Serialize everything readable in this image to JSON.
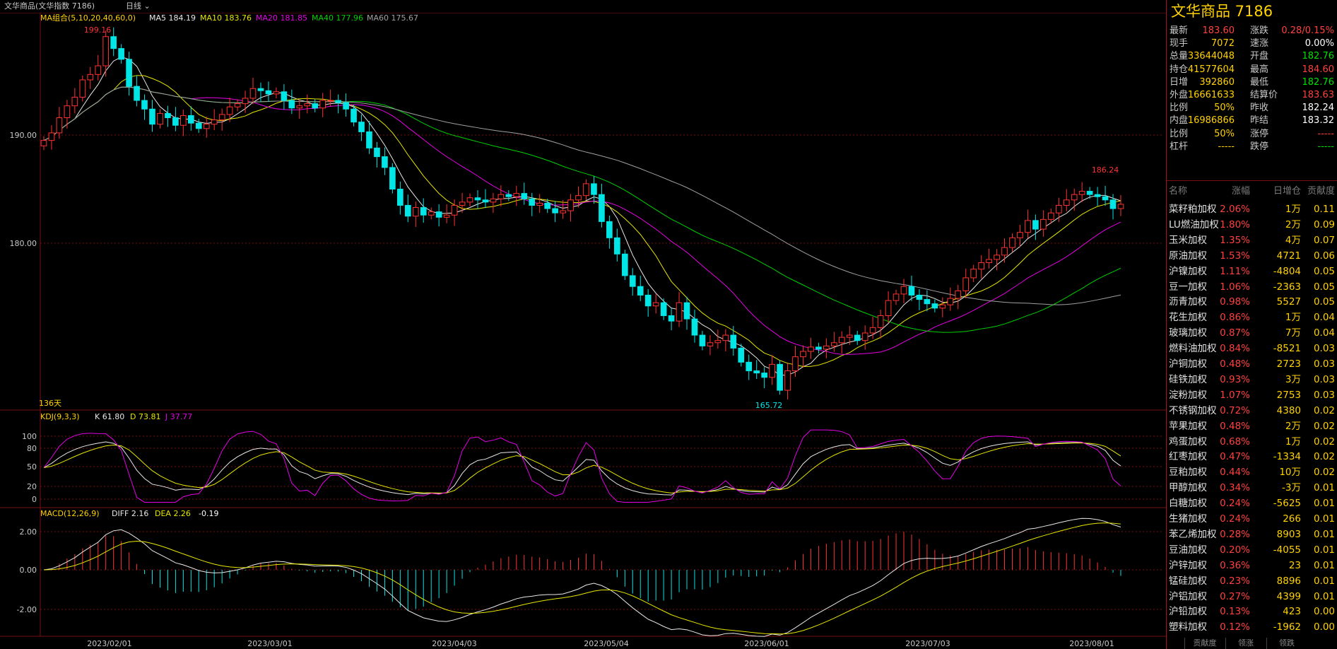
{
  "window": {
    "title": "文华商品(文华指数 7186)",
    "period": "日线"
  },
  "colors": {
    "up": "#ff3232",
    "down": "#00e5e5",
    "ma5": "#e8e8e8",
    "ma10": "#e6e600",
    "ma20": "#e600e6",
    "ma40": "#00d000",
    "ma60": "#a0a0a0",
    "grid": "#7a1010",
    "label": "#ffd200"
  },
  "main_panel": {
    "ma_legend": {
      "name": "MA组合(5,10,20,40,60,0)",
      "ma5": "MA5 184.19",
      "ma10": "MA10 183.76",
      "ma20": "MA20 181.85",
      "ma40": "MA40 177.96",
      "ma60": "MA60 175.67"
    },
    "y_ticks": [
      "190.00",
      "180.00"
    ],
    "high_label": "199.16",
    "low_label": "165.72",
    "recent_high_label": "186.24",
    "day_count": "136天"
  },
  "kdj_panel": {
    "name": "KDJ(9,3,3)",
    "k": "K 61.80",
    "d": "D 73.81",
    "j": "J 37.77",
    "y_ticks": [
      "100",
      "80",
      "50",
      "20",
      "0"
    ]
  },
  "macd_panel": {
    "name": "MACD(12,26,9)",
    "diff": "DIFF 2.16",
    "dea": "DEA 2.26",
    "macd": "-0.19",
    "y_ticks": [
      "2.00",
      "0.00",
      "-2.00"
    ]
  },
  "x_axis": {
    "ticks": [
      "2023/02/01",
      "2023/03/01",
      "2023/04/03",
      "2023/05/04",
      "2023/06/01",
      "2023/07/03",
      "2023/08/01"
    ]
  },
  "chart_data": {
    "type": "candlestick",
    "y_range": [
      165.72,
      199.16
    ],
    "ma_last": {
      "MA5": 184.19,
      "MA10": 183.76,
      "MA20": 181.85,
      "MA40": 177.96,
      "MA60": 175.67
    },
    "close_approx": [
      189.5,
      190.2,
      191.6,
      192.7,
      193.5,
      195.1,
      195.6,
      196.4,
      199.1,
      198.0,
      197.0,
      194.5,
      193.2,
      192.4,
      191.0,
      192.0,
      191.6,
      190.9,
      191.8,
      191.1,
      190.6,
      191.0,
      191.4,
      191.9,
      192.6,
      192.9,
      193.4,
      194.3,
      194.1,
      193.8,
      194.0,
      193.2,
      192.5,
      192.7,
      192.9,
      192.5,
      193.2,
      193.2,
      193.0,
      192.4,
      191.2,
      190.3,
      188.8,
      188.0,
      187.0,
      185.0,
      183.5,
      182.5,
      183.3,
      182.6,
      182.9,
      182.4,
      182.6,
      183.5,
      183.8,
      184.2,
      184.0,
      183.8,
      184.1,
      184.5,
      184.3,
      184.6,
      184.1,
      183.5,
      183.7,
      183.2,
      182.8,
      183.0,
      184.0,
      184.4,
      185.5,
      184.5,
      182.0,
      180.5,
      179.0,
      177.0,
      176.0,
      175.2,
      174.2,
      174.5,
      173.3,
      172.8,
      174.5,
      173.0,
      171.5,
      170.5,
      170.8,
      171.0,
      171.5,
      170.3,
      169.0,
      168.2,
      168.0,
      167.6,
      168.8,
      166.4,
      168.2,
      169.5,
      170.0,
      170.4,
      170.2,
      170.5,
      170.8,
      171.3,
      171.5,
      171.0,
      171.7,
      172.2,
      173.3,
      174.7,
      175.3,
      176.0,
      175.2,
      174.8,
      174.4,
      174.0,
      174.3,
      174.9,
      175.6,
      176.8,
      177.6,
      178.2,
      178.5,
      178.9,
      179.6,
      180.5,
      181.0,
      182.1,
      181.3,
      182.2,
      182.8,
      183.5,
      184.0,
      184.5,
      184.8,
      184.5,
      184.3,
      184.0,
      183.2,
      183.6
    ],
    "kdj_last": {
      "K": 61.8,
      "D": 73.81,
      "J": 37.77
    },
    "macd_last": {
      "DIFF": 2.16,
      "DEA": 2.26,
      "MACD": -0.19
    }
  },
  "quote": {
    "title": "文华商品 7186",
    "rows": [
      {
        "l1": "最新",
        "v1": "183.60",
        "c1": "#ff4040",
        "l2": "涨跌",
        "v2": "0.28/0.15%",
        "c2": "#ff4040"
      },
      {
        "l1": "现手",
        "v1": "7072",
        "c1": "#ffd200",
        "l2": "速涨",
        "v2": "0.00%",
        "c2": "#ffffff"
      },
      {
        "l1": "总量",
        "v1": "33644048",
        "c1": "#ffd200",
        "l2": "开盘",
        "v2": "182.76",
        "c2": "#00e000"
      },
      {
        "l1": "持仓",
        "v1": "41577604",
        "c1": "#ffd200",
        "l2": "最高",
        "v2": "184.60",
        "c2": "#ff4040"
      },
      {
        "l1": "日增",
        "v1": "392860",
        "c1": "#ffd200",
        "l2": "最低",
        "v2": "182.76",
        "c2": "#00e000"
      },
      {
        "l1": "外盘",
        "v1": "16661633",
        "c1": "#ffd200",
        "l2": "结算价",
        "v2": "183.63",
        "c2": "#ff4040"
      },
      {
        "l1": "比例",
        "v1": "50%",
        "c1": "#ffd200",
        "l2": "昨收",
        "v2": "182.24",
        "c2": "#ffffff"
      },
      {
        "l1": "内盘",
        "v1": "16986866",
        "c1": "#ffd200",
        "l2": "昨结",
        "v2": "183.32",
        "c2": "#ffffff"
      },
      {
        "l1": "比例",
        "v1": "50%",
        "c1": "#ffd200",
        "l2": "涨停",
        "v2": "-----",
        "c2": "#ff4040"
      },
      {
        "l1": "杠杆",
        "v1": "-----",
        "c1": "#ffd200",
        "l2": "跌停",
        "v2": "-----",
        "c2": "#00e000"
      }
    ]
  },
  "contrib_table": {
    "headers": [
      "名称",
      "涨幅",
      "日增仓",
      "贡献度"
    ],
    "rows": [
      [
        "菜籽粕加权",
        "2.06%",
        "1万",
        "0.11"
      ],
      [
        "LU燃油加权",
        "1.80%",
        "2万",
        "0.09"
      ],
      [
        "玉米加权",
        "1.35%",
        "4万",
        "0.07"
      ],
      [
        "原油加权",
        "1.53%",
        "4721",
        "0.06"
      ],
      [
        "沪镍加权",
        "1.11%",
        "-4804",
        "0.05"
      ],
      [
        "豆一加权",
        "1.06%",
        "-2363",
        "0.05"
      ],
      [
        "沥青加权",
        "0.98%",
        "5527",
        "0.05"
      ],
      [
        "花生加权",
        "0.86%",
        "1万",
        "0.04"
      ],
      [
        "玻璃加权",
        "0.87%",
        "7万",
        "0.04"
      ],
      [
        "燃料油加权",
        "0.84%",
        "-8521",
        "0.03"
      ],
      [
        "沪铜加权",
        "0.48%",
        "2723",
        "0.03"
      ],
      [
        "硅铁加权",
        "0.93%",
        "3万",
        "0.03"
      ],
      [
        "淀粉加权",
        "1.07%",
        "2753",
        "0.03"
      ],
      [
        "不锈钢加权",
        "0.72%",
        "4380",
        "0.02"
      ],
      [
        "苹果加权",
        "0.48%",
        "2万",
        "0.02"
      ],
      [
        "鸡蛋加权",
        "0.68%",
        "1万",
        "0.02"
      ],
      [
        "红枣加权",
        "0.47%",
        "-1334",
        "0.02"
      ],
      [
        "豆粕加权",
        "0.44%",
        "10万",
        "0.02"
      ],
      [
        "甲醇加权",
        "0.34%",
        "-3万",
        "0.01"
      ],
      [
        "白糖加权",
        "0.24%",
        "-5625",
        "0.01"
      ],
      [
        "生猪加权",
        "0.24%",
        "266",
        "0.01"
      ],
      [
        "苯乙烯加权",
        "0.28%",
        "8903",
        "0.01"
      ],
      [
        "豆油加权",
        "0.20%",
        "-4055",
        "0.01"
      ],
      [
        "沪锌加权",
        "0.36%",
        "23",
        "0.01"
      ],
      [
        "锰硅加权",
        "0.23%",
        "8896",
        "0.01"
      ],
      [
        "沪铝加权",
        "0.27%",
        "4399",
        "0.01"
      ],
      [
        "沪铅加权",
        "0.13%",
        "423",
        "0.00"
      ],
      [
        "塑料加权",
        "0.12%",
        "-1962",
        "0.00"
      ]
    ]
  },
  "bottom_tabs": [
    "贡献度",
    "领涨",
    "领跌"
  ]
}
